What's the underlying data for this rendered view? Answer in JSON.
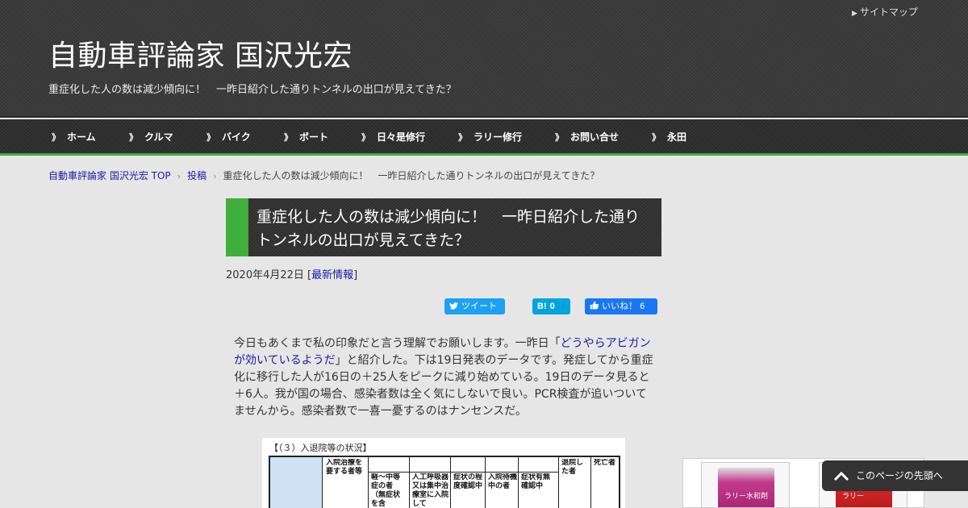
{
  "header": {
    "sitemap_label": "サイトマップ",
    "site_title": "自動車評論家 国沢光宏",
    "site_description": "重症化した人の数は減少傾向に！　一昨日紹介した通りトンネルの出口が見えてきた？"
  },
  "nav": {
    "items": [
      {
        "label": "ホーム"
      },
      {
        "label": "クルマ"
      },
      {
        "label": "バイク"
      },
      {
        "label": "ボート"
      },
      {
        "label": "日々是修行"
      },
      {
        "label": "ラリー修行"
      },
      {
        "label": "お問い合せ"
      },
      {
        "label": "永田"
      }
    ]
  },
  "breadcrumb": {
    "home": "自動車評論家 国沢光宏 TOP",
    "section": "投稿",
    "current": "重症化した人の数は減少傾向に！　一昨日紹介した通りトンネルの出口が見えてきた？"
  },
  "post": {
    "title": "重症化した人の数は減少傾向に！　一昨日紹介した通りトンネルの出口が見えてきた？",
    "date": "2020年4月22日",
    "category": "最新情報",
    "body_before_link": "今日もあくまで私の印象だと言う理解でお願いします。一昨日「",
    "body_link": "どうやらアビガンが効いているようだ",
    "body_after_link": "」と紹介した。下は19日発表のデータです。発症してから重症化に移行した人が16日の＋25人をピークに減り始めている。19日のデータ見ると＋6人。我が国の場合、感染者数は全く気にしないで良い。PCR検査が追いついてませんから。感染者数で一喜一憂するのはナンセンスだ。"
  },
  "share": {
    "tweet_label": "ツイート",
    "hatena_label": "B!",
    "hatena_count": "0",
    "like_label": "いいね！",
    "like_count": "6"
  },
  "table_image": {
    "caption": "【（３）入退院等の状況】",
    "cells": {
      "admitted": "入院治療を要する者等",
      "mild": "軽～中等症の者（無症状を含",
      "ventilator": "人工呼吸器又は集中治療室に入院して",
      "severity_check": "症状の程度確認中",
      "waiting": "入院待機中の者",
      "symptom_check": "症状有無確認中",
      "discharged": "退院した者",
      "deceased": "死亡者"
    }
  },
  "sidebar": {
    "product_1_label": "ラリー水和剤",
    "product_2_label": "ラリー"
  },
  "to_top": {
    "label": "このページの先頭へ"
  },
  "colors": {
    "accent_green": "#3fae3b",
    "link_blue": "#1a1aa6",
    "twitter": "#1da1f2",
    "hatena": "#00a4de",
    "facebook": "#1877f2"
  }
}
